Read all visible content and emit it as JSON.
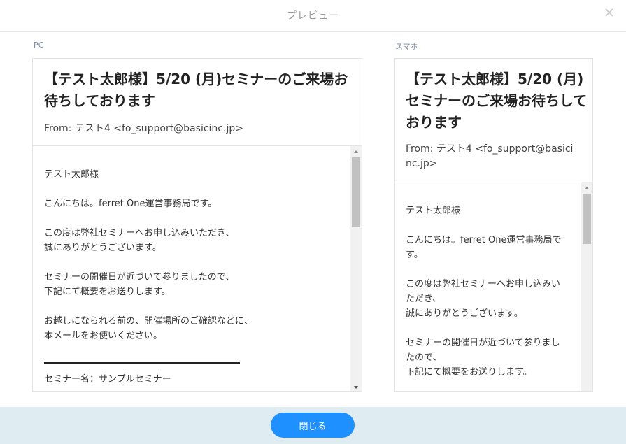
{
  "header": {
    "title": "プレビュー",
    "close_icon": "close-icon"
  },
  "pc": {
    "label": "PC",
    "subject": "【テスト太郎様】5/20 (月)セミナーのご来場お待ちしております",
    "from": "From: テスト4 <fo_support@basicinc.jp>",
    "body": {
      "p1": "テスト太郎様",
      "p2": "こんにちは。ferret One運営事務局です。",
      "p3": "この度は弊社セミナーへお申し込みいただき、\n誠にありがとうございます。",
      "p4": "セミナーの開催日が近づいて参りましたので、\n下記にて概要をお送りします。",
      "p5": "お越しになられる前の、開催場所のご確認などに、\n本メールをお使いください。",
      "p6": "セミナー名：サンプルセミナー"
    }
  },
  "sp": {
    "label": "スマホ",
    "subject": "【テスト太郎様】5/20 (月)セミナーのご来場お待ちしております",
    "from": "From: テスト4 <fo_support@basicinc.jp>",
    "body": {
      "p1": "テスト太郎様",
      "p2": "こんにちは。ferret One運営事務局です。",
      "p3": "この度は弊社セミナーへお申し込みいただき、\n誠にありがとうございます。",
      "p4": "セミナーの開催日が近づいて参りましたので、\n下記にて概要をお送りします。"
    }
  },
  "footer": {
    "close_label": "閉じる"
  }
}
